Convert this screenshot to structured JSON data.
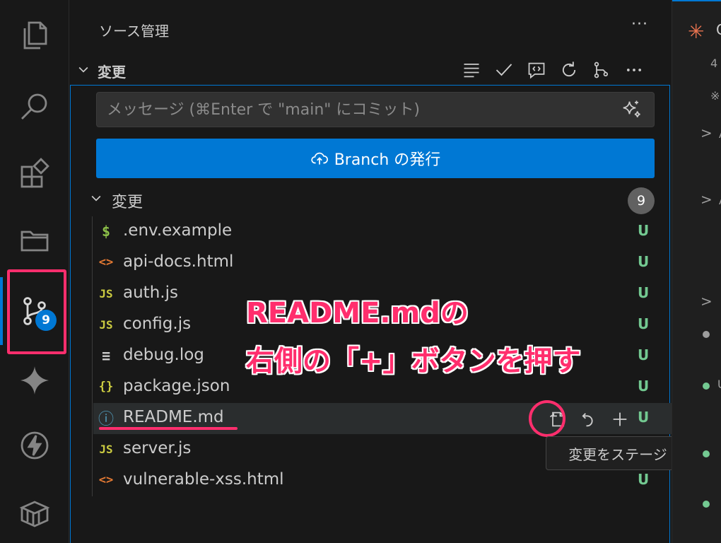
{
  "activity_bar": {
    "items": [
      {
        "icon": "files-icon"
      },
      {
        "icon": "search-icon"
      },
      {
        "icon": "extensions-icon"
      },
      {
        "icon": "folder-icon"
      },
      {
        "icon": "source-control-icon",
        "badge": "9",
        "active": true
      },
      {
        "icon": "sparkle-icon"
      },
      {
        "icon": "lightning-icon"
      },
      {
        "icon": "container-icon"
      }
    ]
  },
  "panel": {
    "title": "ソース管理",
    "more": "···",
    "section_label": "変更",
    "commit_placeholder": "メッセージ (⌘Enter で \"main\" にコミット)",
    "publish_label": "Branch の発行",
    "changes_label": "変更",
    "changes_count": "9"
  },
  "files": [
    {
      "icon": "$",
      "icon_color": "#8dc149",
      "name": ".env.example",
      "status": "U"
    },
    {
      "icon": "<>",
      "icon_color": "#e37933",
      "name": "api-docs.html",
      "status": "U"
    },
    {
      "icon": "JS",
      "icon_color": "#cbcb41",
      "name": "auth.js",
      "status": "U"
    },
    {
      "icon": "JS",
      "icon_color": "#cbcb41",
      "name": "config.js",
      "status": "U"
    },
    {
      "icon": "≡",
      "icon_color": "#cccccc",
      "name": "debug.log",
      "status": "U"
    },
    {
      "icon": "{}",
      "icon_color": "#cbcb41",
      "name": "package.json",
      "status": "U"
    },
    {
      "icon": "ⓘ",
      "icon_color": "#519aba",
      "name": "README.md",
      "status": "U"
    },
    {
      "icon": "JS",
      "icon_color": "#cbcb41",
      "name": "server.js",
      "status": "U"
    },
    {
      "icon": "<>",
      "icon_color": "#e37933",
      "name": "vulnerable-xss.html",
      "status": "U"
    }
  ],
  "tooltip": "変更をステージ",
  "annotation": {
    "line1": "README.mdの",
    "line2": "右側の「+」ボタンを押す"
  },
  "editor_peek": {
    "line_number": "4",
    "glyph_note": "※",
    "arrow": ">",
    "tab_letter": "C",
    "letter_u": "U",
    "letter_a": "A"
  },
  "colors": {
    "accent": "#0078d4",
    "annotation": "#ff2e6d",
    "untracked": "#73c991"
  }
}
